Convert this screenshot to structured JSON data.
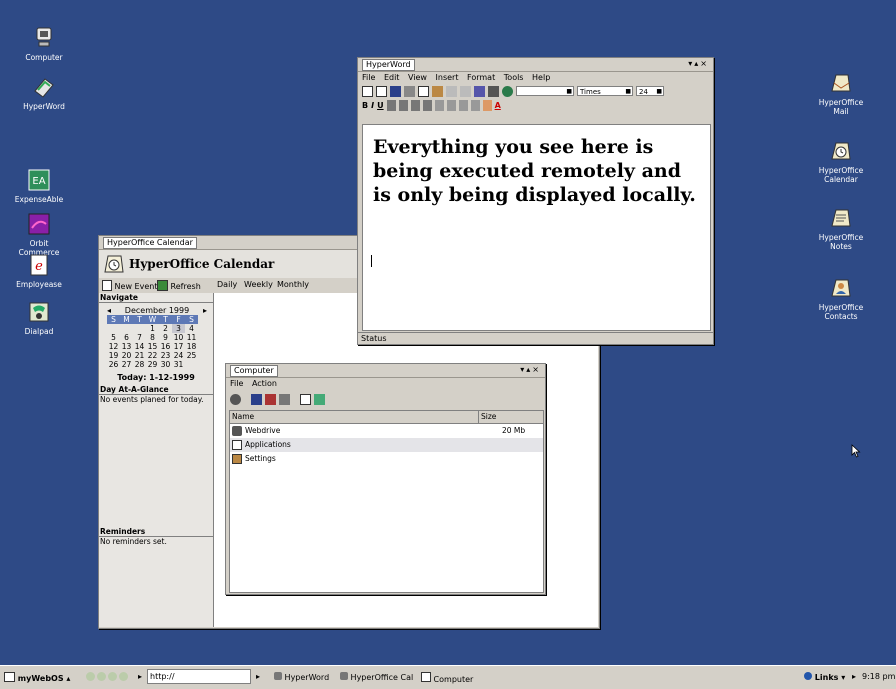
{
  "desktop": {
    "icons_left": [
      {
        "label": "Computer",
        "icon": "computer-icon"
      },
      {
        "label": "HyperWord",
        "icon": "hyperword-icon"
      },
      {
        "label": "ExpenseAble",
        "icon": "expenseable-icon"
      },
      {
        "label": "Orbit Commerce",
        "icon": "orbit-commerce-icon"
      },
      {
        "label": "Employease",
        "icon": "employease-icon"
      },
      {
        "label": "Dialpad",
        "icon": "dialpad-icon"
      }
    ],
    "icons_right": [
      {
        "label": "HyperOffice Mail",
        "icon": "mail-icon"
      },
      {
        "label": "HyperOffice Calendar",
        "icon": "calendar-icon"
      },
      {
        "label": "HyperOffice Notes",
        "icon": "notes-icon"
      },
      {
        "label": "HyperOffice Contacts",
        "icon": "contacts-icon"
      }
    ]
  },
  "hyperword": {
    "title": "HyperWord",
    "window_controls": "▾▴×",
    "menu": [
      "File",
      "Edit",
      "View",
      "Insert",
      "Format",
      "Tools",
      "Help"
    ],
    "font_name": "Times",
    "font_size": "24",
    "document_text": "Everything you see here is being executed remotely and is only being displayed locally.",
    "status": "Status"
  },
  "calendar": {
    "title": "HyperOffice Calendar",
    "app_title": "HyperOffice Calendar",
    "toolbar": {
      "new_event": "New Event",
      "refresh": "Refresh",
      "daily": "Daily",
      "weekly": "Weekly",
      "monthly": "Monthly"
    },
    "navigate_label": "Navigate",
    "month": "December 1999",
    "dow": [
      "S",
      "M",
      "T",
      "W",
      "T",
      "F",
      "S"
    ],
    "weeks": [
      [
        "",
        "",
        "",
        "1",
        "2",
        "3",
        "4"
      ],
      [
        "5",
        "6",
        "7",
        "8",
        "9",
        "10",
        "11"
      ],
      [
        "12",
        "13",
        "14",
        "15",
        "16",
        "17",
        "18"
      ],
      [
        "19",
        "20",
        "21",
        "22",
        "23",
        "24",
        "25"
      ],
      [
        "26",
        "27",
        "28",
        "29",
        "30",
        "31",
        ""
      ]
    ],
    "today_label": "Today: 1-12-1999",
    "day_at_a_glance_label": "Day At-A-Glance",
    "no_events": "No events planed for today.",
    "reminders_label": "Reminders",
    "no_reminders": "No reminders set."
  },
  "computer": {
    "title": "Computer",
    "window_controls": "▾▴×",
    "menu": [
      "File",
      "Action"
    ],
    "columns": {
      "name": "Name",
      "size": "Size"
    },
    "rows": [
      {
        "name": "Webdrive",
        "size": "20 Mb",
        "icon": "drive-icon"
      },
      {
        "name": "Applications",
        "size": "",
        "icon": "folder-icon"
      },
      {
        "name": "Settings",
        "size": "",
        "icon": "settings-icon"
      }
    ]
  },
  "taskbar": {
    "start": "myWebOS",
    "address": "http://",
    "tasks": [
      "HyperWord",
      "HyperOffice Cal",
      "Computer"
    ],
    "links": "Links",
    "clock": "9:18 pm"
  },
  "colors": {
    "desktop": "#2e4a86",
    "chrome": "#d4d0c8",
    "calendar_header": "#5e79b6"
  }
}
